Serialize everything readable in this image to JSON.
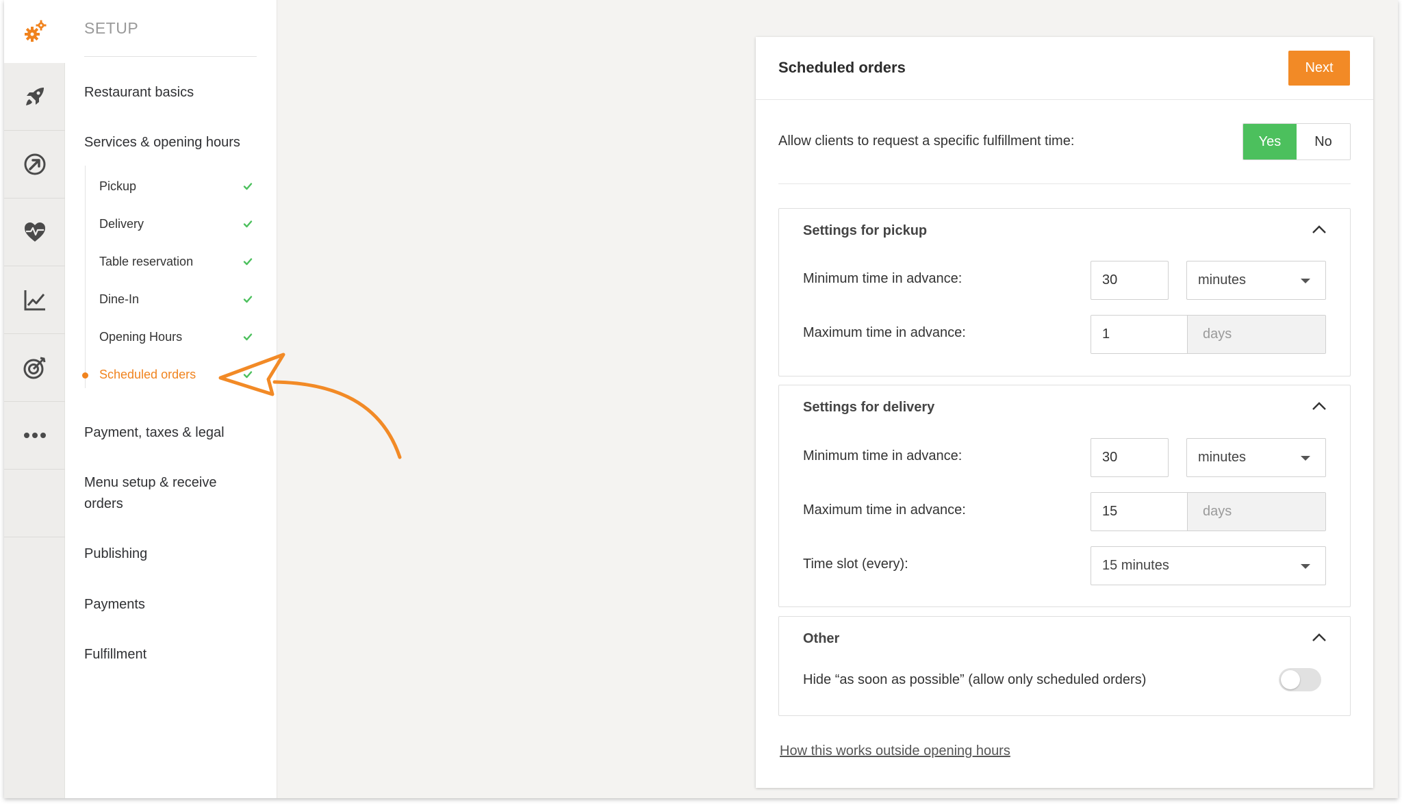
{
  "rail": {
    "icons": [
      "gears-icon",
      "rocket-icon",
      "growth-icon",
      "heart-pulse-icon",
      "chart-icon",
      "target-icon",
      "more-icon"
    ]
  },
  "sidebar": {
    "title": "SETUP",
    "sections": [
      {
        "label": "Restaurant basics"
      },
      {
        "label": "Services & opening hours"
      },
      {
        "label": "Payment, taxes & legal"
      },
      {
        "label": "Menu setup & receive orders"
      },
      {
        "label": "Publishing"
      },
      {
        "label": "Payments"
      },
      {
        "label": "Fulfillment"
      }
    ],
    "subitems": [
      {
        "label": "Pickup",
        "done": true
      },
      {
        "label": "Delivery",
        "done": true
      },
      {
        "label": "Table reservation",
        "done": true
      },
      {
        "label": "Dine-In",
        "done": true
      },
      {
        "label": "Opening Hours",
        "done": true
      },
      {
        "label": "Scheduled orders",
        "done": true,
        "active": true
      }
    ]
  },
  "card": {
    "title": "Scheduled orders",
    "next_label": "Next",
    "allow": {
      "label": "Allow clients to request a specific fulfillment time:",
      "yes_label": "Yes",
      "no_label": "No",
      "selected": "Yes"
    },
    "pickup": {
      "title": "Settings for pickup",
      "min_label": "Minimum time in advance:",
      "min_value": "30",
      "min_unit": "minutes",
      "max_label": "Maximum time in advance:",
      "max_value": "1",
      "max_unit": "days"
    },
    "delivery": {
      "title": "Settings for delivery",
      "min_label": "Minimum time in advance:",
      "min_value": "30",
      "min_unit": "minutes",
      "max_label": "Maximum time in advance:",
      "max_value": "15",
      "max_unit": "days",
      "slot_label": "Time slot (every):",
      "slot_value": "15 minutes"
    },
    "other": {
      "title": "Other",
      "hide_label": "Hide “as soon as possible” (allow only scheduled orders)",
      "hide_enabled": false
    },
    "help_link": "How this works outside opening hours"
  },
  "colors": {
    "accent": "#f0831e",
    "yes_green": "#4cc05d",
    "check_green": "#4cc05d"
  }
}
